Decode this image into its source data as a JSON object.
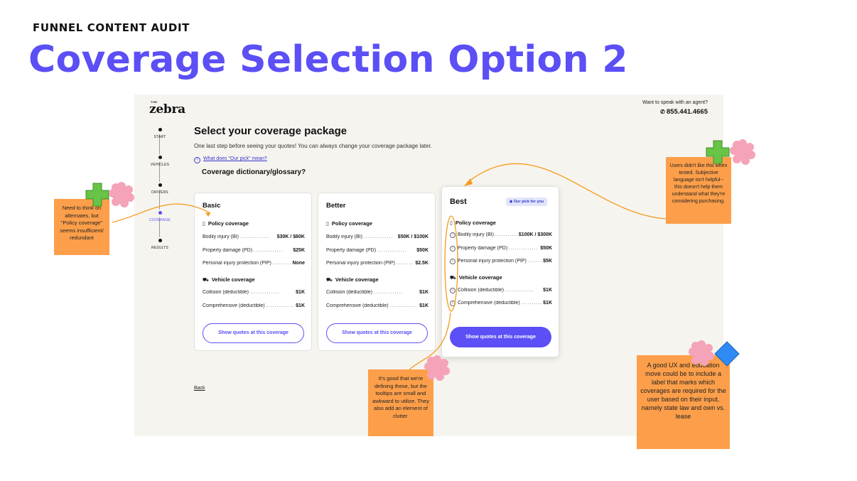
{
  "slide": {
    "eyebrow": "FUNNEL CONTENT AUDIT",
    "title": "Coverage Selection Option 2"
  },
  "app": {
    "logo_small": "THE",
    "logo": "zebra",
    "agent_question": "Want to speak with an agent?",
    "agent_phone": "855.441.4665",
    "steps": [
      {
        "label": "START"
      },
      {
        "label": "VEHICLES"
      },
      {
        "label": "DRIVERS"
      },
      {
        "label": "COVERAGE"
      },
      {
        "label": "RESULTS"
      }
    ],
    "active_step": "COVERAGE",
    "heading": "Select your coverage package",
    "subheading": "One last step before seeing your quotes! You can always change your coverage package later.",
    "our_pick_link": "What does \"Our pick\" mean?",
    "glossary_note": "Coverage dictionary/glossary?",
    "back_link": "Back",
    "accent_color": "#5b4ff5",
    "cards": [
      {
        "name": "Basic",
        "policy_title": "Policy coverage",
        "policy_rows": [
          {
            "label": "Bodily injury (BI)",
            "value": "$30K / $60K"
          },
          {
            "label": "Property damage (PD)",
            "value": "$25K"
          },
          {
            "label": "Personal injury protection (PIP)",
            "value": "None"
          }
        ],
        "vehicle_title": "Vehicle coverage",
        "vehicle_rows": [
          {
            "label": "Collision (deductible)",
            "value": "$1K"
          },
          {
            "label": "Comprehensive (deductible)",
            "value": "$1K"
          }
        ],
        "button": "Show quotes at this coverage"
      },
      {
        "name": "Better",
        "policy_title": "Policy coverage",
        "policy_rows": [
          {
            "label": "Bodily injury (BI)",
            "value": "$50K / $100K"
          },
          {
            "label": "Property damage (PD)",
            "value": "$50K"
          },
          {
            "label": "Personal injury protection (PIP)",
            "value": "$2.5K"
          }
        ],
        "vehicle_title": "Vehicle coverage",
        "vehicle_rows": [
          {
            "label": "Collision (deductible)",
            "value": "$1K"
          },
          {
            "label": "Comprehensive (deductible)",
            "value": "$1K"
          }
        ],
        "button": "Show quotes at this coverage"
      },
      {
        "name": "Best",
        "badge": "Our pick for you",
        "policy_title": "Policy coverage",
        "policy_rows": [
          {
            "label": "Bodily injury (BI)",
            "value": "$100K / $300K"
          },
          {
            "label": "Property damage (PD)",
            "value": "$50K"
          },
          {
            "label": "Personal injury protection (PIP)",
            "value": "$5K"
          }
        ],
        "vehicle_title": "Vehicle coverage",
        "vehicle_rows": [
          {
            "label": "Collision (deductible)",
            "value": "$1K"
          },
          {
            "label": "Comprehensive (deductible)",
            "value": "$1K"
          }
        ],
        "button": "Show quotes at this coverage"
      }
    ]
  },
  "notes": {
    "left": "Need to think on alternates, but \"Policy coverage\" seems insufficient/ redundant",
    "top_right": "Users didn't like this when tested. Subjective language isn't helpful-- this doesn't help them understand what they're considering purchasing.",
    "bottom_middle": "It's good that we're defining these, but the tooltips are small and awkward to utilize. They also add an element of clutter.",
    "bottom_right": "A good UX and education move could be to include a label that marks which coverages are required for the user based on their input, namely state law and own vs. lease"
  },
  "colors": {
    "sticky": "#fd9f4a",
    "plus": "#67c447",
    "blob": "#f5a3b8",
    "diamond": "#2f8af5",
    "connector": "#f59a1a"
  }
}
